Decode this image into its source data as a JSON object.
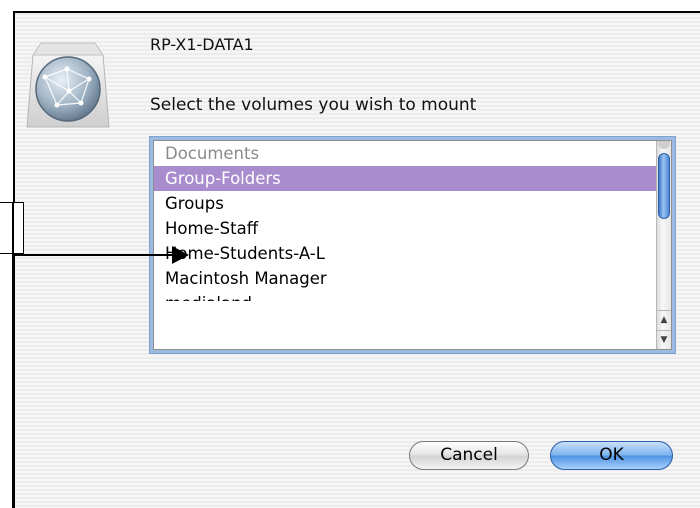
{
  "dialog": {
    "server_name": "RP-X1-DATA1",
    "prompt": "Select the volumes you wish to mount",
    "icon": "network-globe-icon",
    "volumes": [
      {
        "label": "Documents",
        "state": "disabled"
      },
      {
        "label": "Group-Folders",
        "state": "selected"
      },
      {
        "label": "Groups",
        "state": "normal"
      },
      {
        "label": "Home-Staff",
        "state": "normal"
      },
      {
        "label": "Home-Students-A-L",
        "state": "normal"
      },
      {
        "label": "Macintosh Manager",
        "state": "normal"
      },
      {
        "label": "medialand",
        "state": "partially-visible"
      }
    ],
    "buttons": {
      "cancel": "Cancel",
      "ok": "OK"
    }
  },
  "colors": {
    "selection": "#a98ccd",
    "focus_ring": "#9cbbe0",
    "default_button": "#4c92e4"
  }
}
